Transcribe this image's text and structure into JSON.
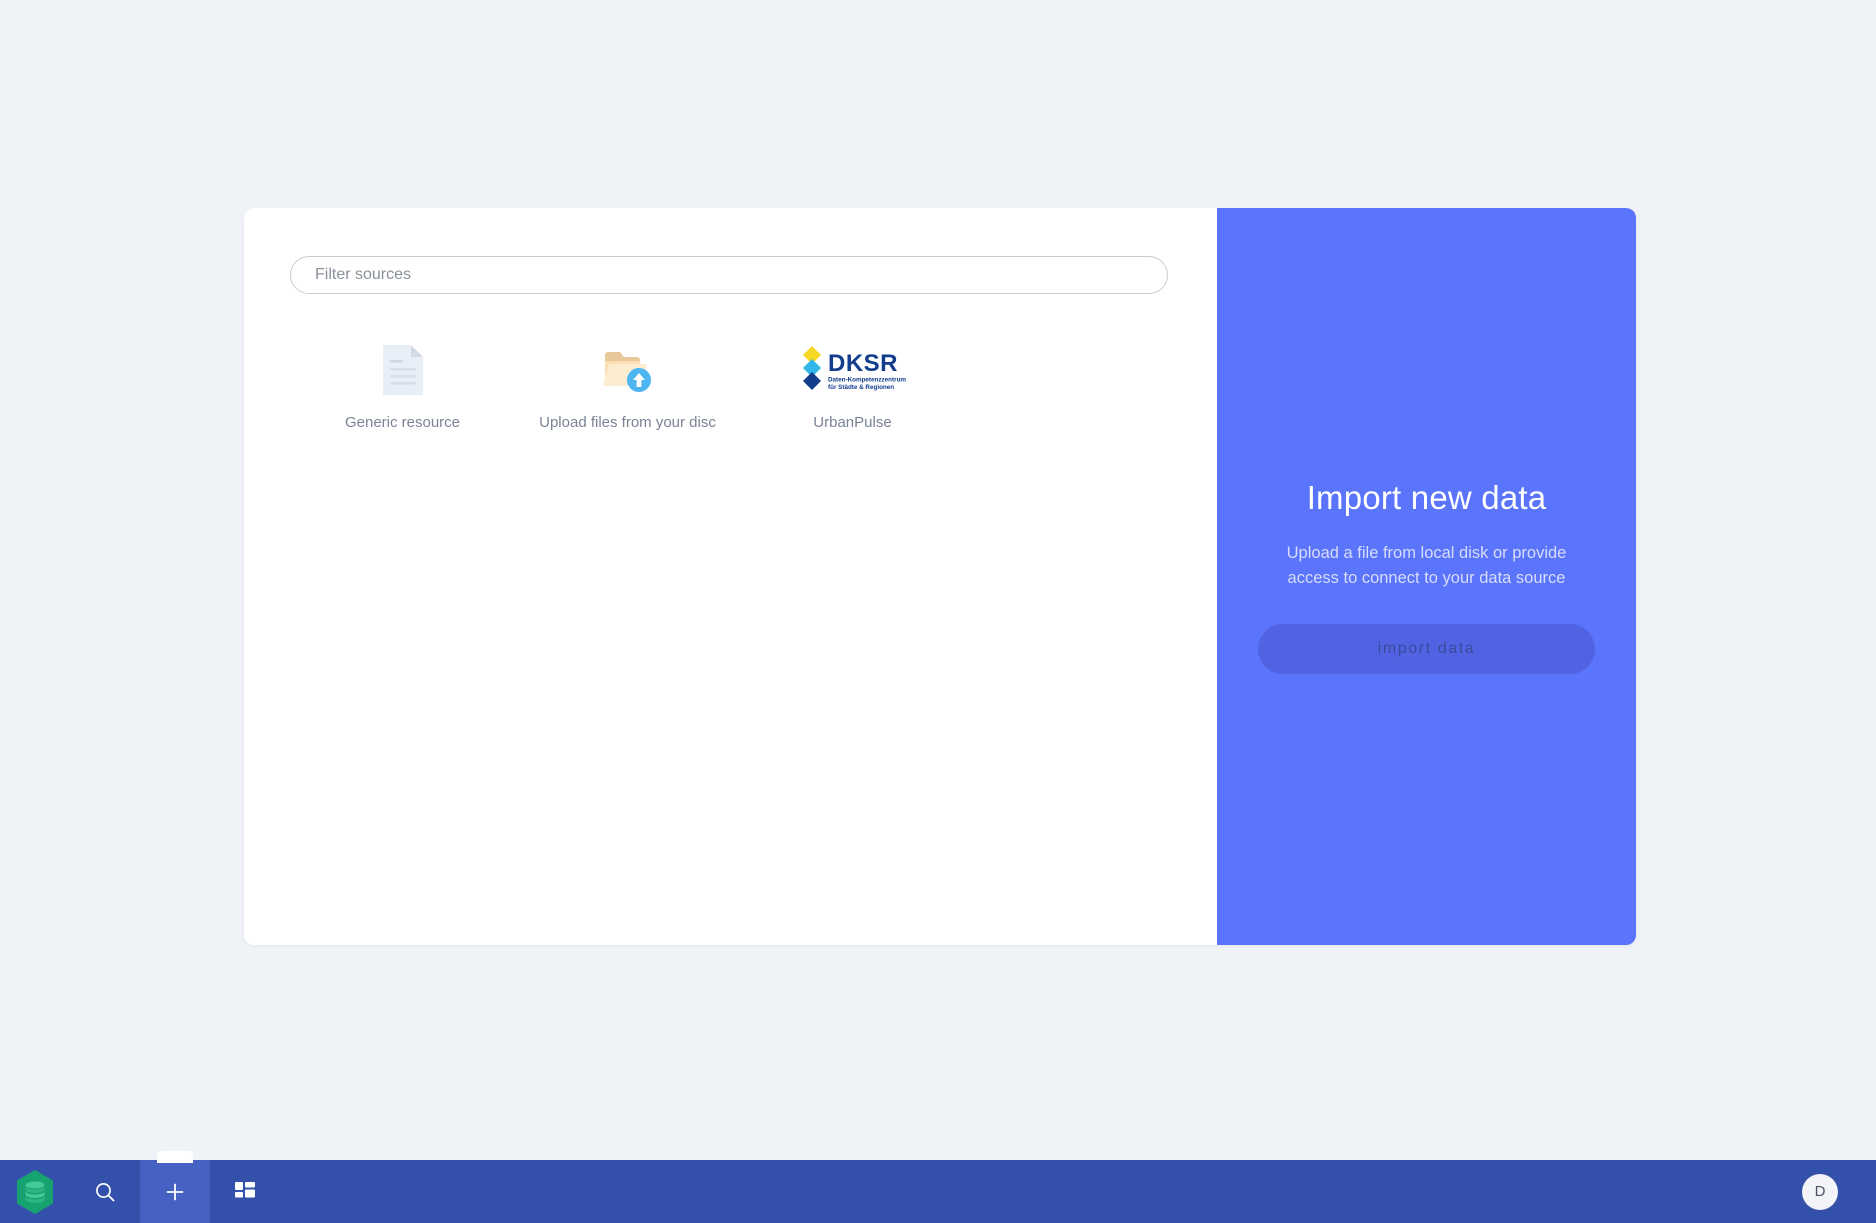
{
  "theme": {
    "page_bg": "#eff2f7",
    "panel_bg": "#ffffff",
    "accent_blue": "#5a74fb",
    "taskbar_blue": "#3350ab",
    "taskbar_active": "#4561c2",
    "logo_green": "#17a271"
  },
  "filter": {
    "placeholder": "Filter sources",
    "value": ""
  },
  "sources": [
    {
      "label": "Generic resource",
      "icon": "document-icon"
    },
    {
      "label": "Upload files from your disc",
      "icon": "folder-upload-icon"
    },
    {
      "label": "UrbanPulse",
      "icon": "dksr-logo-icon",
      "logo": {
        "wordmark": "DKSR",
        "tagline_line1": "Daten-Kompetenzzentrum",
        "tagline_line2": "für Städte & Regionen"
      }
    }
  ],
  "import_panel": {
    "title": "Import new data",
    "subtitle": "Upload a file from local disk or provide access to connect to your data source",
    "button_label": "import data"
  },
  "taskbar": {
    "logo_name": "app-logo",
    "items": [
      {
        "name": "search",
        "icon": "search-icon"
      },
      {
        "name": "add",
        "icon": "plus-icon"
      },
      {
        "name": "dashboard",
        "icon": "grid-icon"
      }
    ],
    "avatar_initial": "D"
  }
}
